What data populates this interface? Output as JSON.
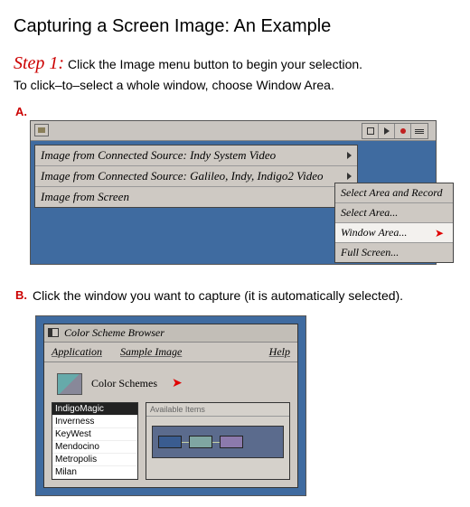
{
  "page": {
    "title": "Capturing a Screen Image: An Example",
    "step_label": "Step 1:",
    "step_text_1": "Click the Image menu button to begin your selection.",
    "step_text_2": "To click–to–select a whole window, choose Window Area."
  },
  "sectionA": {
    "label": "A.",
    "menu_main": [
      "Image from Connected Source: Indy System Video",
      "Image from Connected Source: Galileo, Indy, Indigo2 Video",
      "Image from Screen"
    ],
    "submenu": {
      "items": [
        "Select Area and Record",
        "Select Area...",
        "Window Area...",
        "Full Screen..."
      ],
      "highlighted_index": 2
    }
  },
  "sectionB": {
    "label": "B.",
    "text": "Click the window you want to capture (it is automatically selected).",
    "window": {
      "title": "Color Scheme Browser",
      "menubar": {
        "app": "Application",
        "sample": "Sample Image",
        "help": "Help"
      },
      "heading": "Color Schemes",
      "panel_label": "Available Items",
      "list": [
        "IndigoMagic",
        "Inverness",
        "KeyWest",
        "Mendocino",
        "Metropolis",
        "Milan"
      ],
      "selected_index": 0
    }
  }
}
